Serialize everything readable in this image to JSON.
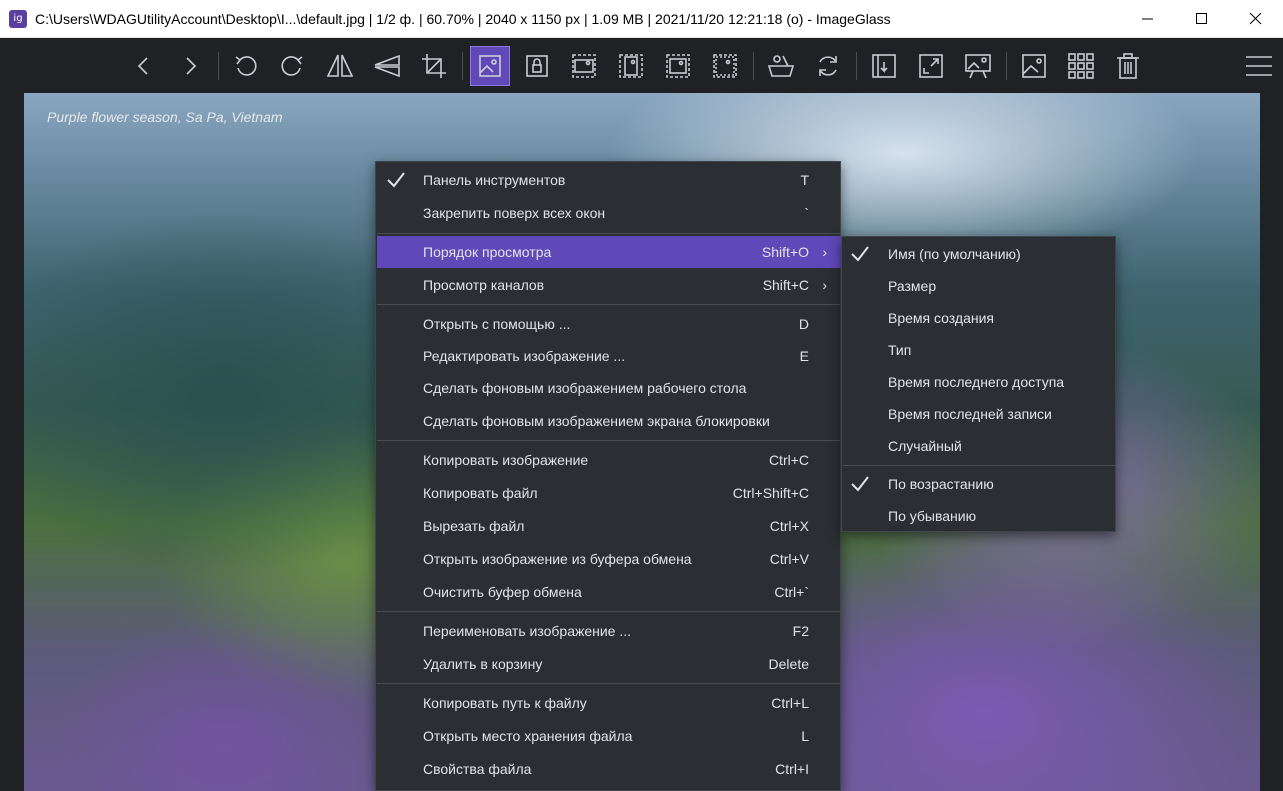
{
  "window": {
    "title": "C:\\Users\\WDAGUtilityAccount\\Desktop\\I...\\default.jpg  |  1/2 ф.  |  60.70%  |  2040 x 1150 px  |  1.09 MB  |  2021/11/20 12:21:18 (o)  - ImageGlass",
    "app_icon_text": "ig"
  },
  "toolbar": {
    "buttons": [
      {
        "name": "back-icon"
      },
      {
        "name": "forward-icon"
      },
      {
        "name": "rotate-left-icon"
      },
      {
        "name": "rotate-right-icon"
      },
      {
        "name": "flip-horizontal-icon"
      },
      {
        "name": "flip-vertical-icon"
      },
      {
        "name": "crop-icon"
      },
      {
        "name": "auto-zoom-icon",
        "active": true
      },
      {
        "name": "lock-zoom-icon"
      },
      {
        "name": "scale-to-width-icon"
      },
      {
        "name": "scale-to-height-icon"
      },
      {
        "name": "scale-to-fit-icon"
      },
      {
        "name": "scale-to-fill-icon"
      },
      {
        "name": "open-file-icon"
      },
      {
        "name": "refresh-icon"
      },
      {
        "name": "goto-image-icon"
      },
      {
        "name": "fullscreen-icon"
      },
      {
        "name": "slideshow-icon"
      },
      {
        "name": "thumbnail-bar-icon"
      },
      {
        "name": "checkerboard-icon"
      },
      {
        "name": "delete-icon"
      },
      {
        "name": "main-menu-icon"
      }
    ],
    "active_color": "#5f49b8"
  },
  "viewer": {
    "caption": "Purple flower season, Sa Pa, Vietnam"
  },
  "menu": {
    "items": [
      {
        "label": "Панель инструментов",
        "shortcut": "T",
        "checked": true
      },
      {
        "label": "Закрепить поверх всех окон",
        "shortcut": "`"
      },
      {
        "label": "Порядок просмотра",
        "shortcut": "Shift+O",
        "submenu": true,
        "highlighted": true
      },
      {
        "label": "Просмотр каналов",
        "shortcut": "Shift+C",
        "submenu": true
      },
      {
        "label": "Открыть с помощью ...",
        "shortcut": "D"
      },
      {
        "label": "Редактировать изображение  ...",
        "shortcut": "E"
      },
      {
        "label": "Сделать фоновым изображением рабочего стола",
        "shortcut": ""
      },
      {
        "label": "Сделать фоновым изображением экрана блокировки",
        "shortcut": ""
      },
      {
        "label": "Копировать изображение",
        "shortcut": "Ctrl+C"
      },
      {
        "label": "Копировать файл",
        "shortcut": "Ctrl+Shift+C"
      },
      {
        "label": "Вырезать файл",
        "shortcut": "Ctrl+X"
      },
      {
        "label": "Открыть изображение из буфера обмена",
        "shortcut": "Ctrl+V"
      },
      {
        "label": "Очистить буфер обмена",
        "shortcut": "Ctrl+`"
      },
      {
        "label": "Переименовать изображение ...",
        "shortcut": "F2"
      },
      {
        "label": "Удалить в корзину",
        "shortcut": "Delete"
      },
      {
        "label": "Копировать путь к файлу",
        "shortcut": "Ctrl+L"
      },
      {
        "label": "Открыть место хранения файла",
        "shortcut": "L"
      },
      {
        "label": "Свойства файла",
        "shortcut": "Ctrl+I"
      }
    ],
    "highlight_color": "#5f49b8"
  },
  "submenu": {
    "items": [
      {
        "label": "Имя (по умолчанию)",
        "checked": true
      },
      {
        "label": "Размер"
      },
      {
        "label": "Время создания"
      },
      {
        "label": "Тип"
      },
      {
        "label": "Время последнего доступа"
      },
      {
        "label": "Время последней записи"
      },
      {
        "label": "Случайный"
      },
      {
        "label": "По возрастанию",
        "checked": true
      },
      {
        "label": "По убыванию"
      }
    ]
  }
}
